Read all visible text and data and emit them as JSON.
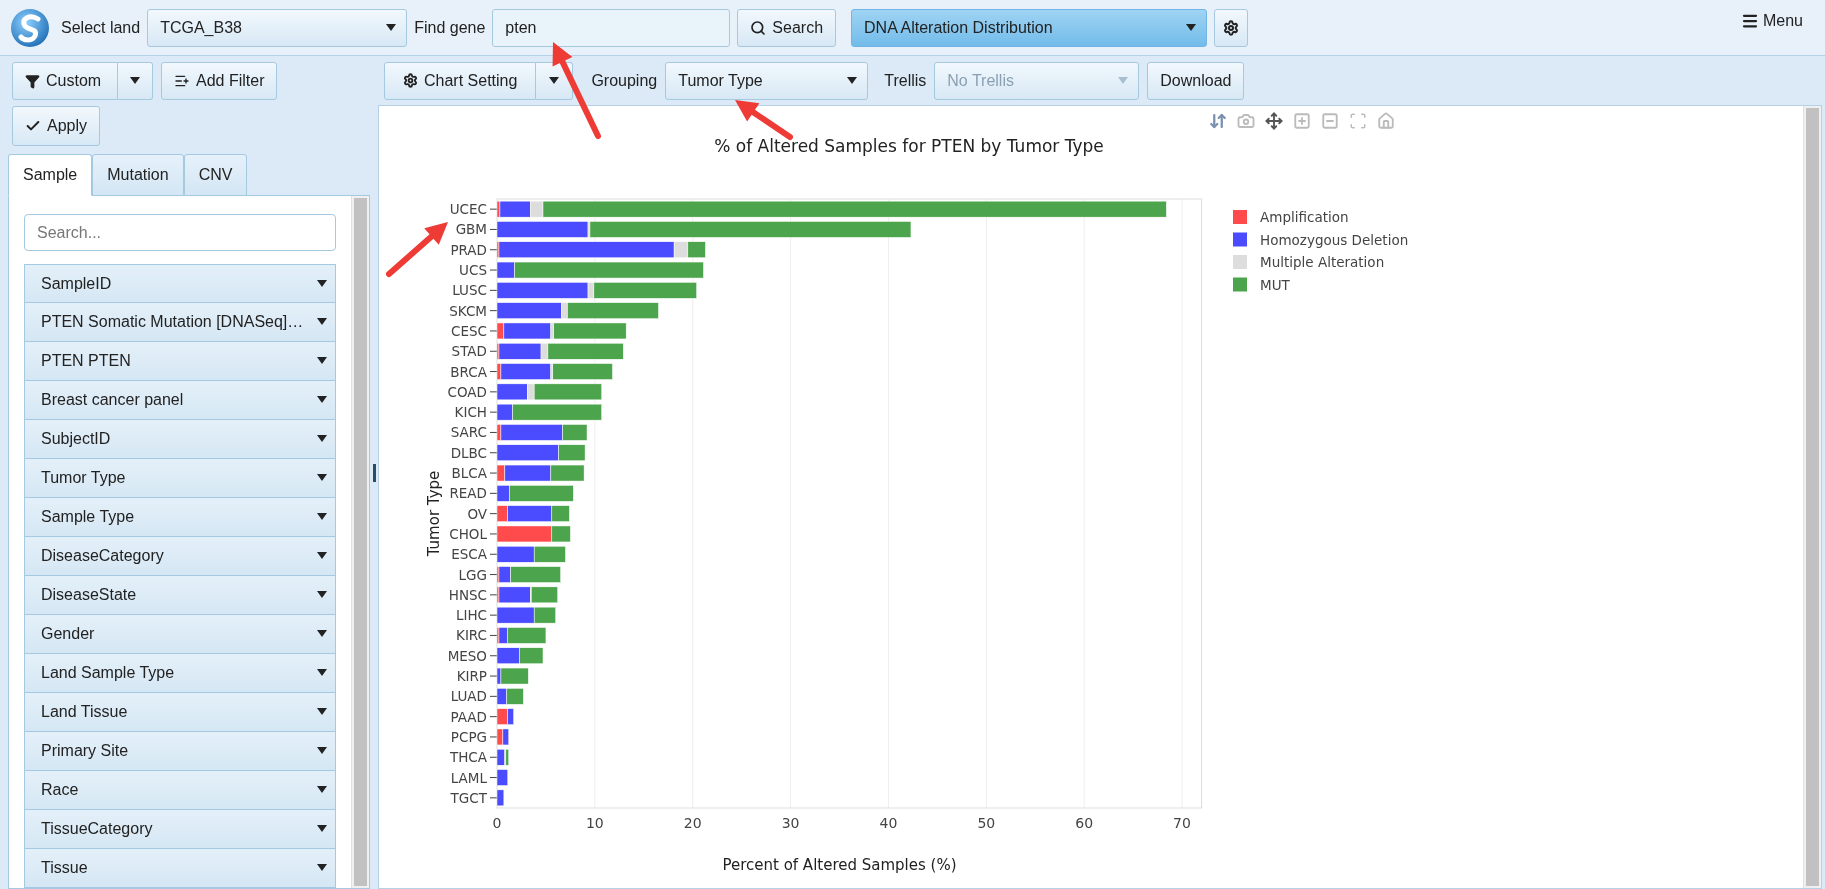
{
  "top_bar": {
    "land_label": "Select land",
    "land_value": "TCGA_B38",
    "gene_label": "Find gene",
    "gene_value": "pten",
    "search_button": "Search",
    "analysis_value": "DNA Alteration Distribution",
    "menu_button": "Menu"
  },
  "filter_bar": {
    "custom_button": "Custom",
    "add_filter_button": "Add Filter",
    "apply_button": "Apply"
  },
  "tabs": [
    {
      "label": "Sample",
      "selected": true
    },
    {
      "label": "Mutation",
      "selected": false
    },
    {
      "label": "CNV",
      "selected": false
    }
  ],
  "sample_search": {
    "placeholder": "Search..."
  },
  "attributes": [
    "SampleID",
    "PTEN Somatic Mutation [DNASeq]…",
    "PTEN PTEN",
    "Breast cancer panel",
    "SubjectID",
    "Tumor Type",
    "Sample Type",
    "DiseaseCategory",
    "DiseaseState",
    "Gender",
    "Land Sample Type",
    "Land Tissue",
    "Primary Site",
    "Race",
    "TissueCategory",
    "Tissue"
  ],
  "chart_toolbar": {
    "chart_setting_button": "Chart Setting",
    "grouping_label": "Grouping",
    "grouping_value": "Tumor Type",
    "trellis_label": "Trellis",
    "trellis_value": "No Trellis",
    "trellis_disabled": true,
    "download_button": "Download"
  },
  "chart": {
    "chart_data": {
      "type": "bar",
      "orientation": "horizontal",
      "stacked": true,
      "title": "% of Altered Samples for PTEN by Tumor Type",
      "xlabel": "Percent of Altered Samples (%)",
      "ylabel": "Tumor Type",
      "xlim": [
        0,
        72
      ],
      "grid": true,
      "legend": true,
      "xticks": [
        0,
        10,
        20,
        30,
        40,
        50,
        60,
        70
      ],
      "categories": [
        "UCEC",
        "GBM",
        "PRAD",
        "UCS",
        "LUSC",
        "SKCM",
        "CESC",
        "STAD",
        "BRCA",
        "COAD",
        "KICH",
        "SARC",
        "DLBC",
        "BLCA",
        "READ",
        "OV",
        "CHOL",
        "ESCA",
        "LGG",
        "HNSC",
        "LIHC",
        "KIRC",
        "MESO",
        "KIRP",
        "LUAD",
        "PAAD",
        "PCPG",
        "THCA",
        "LAML",
        "TGCT"
      ],
      "series": [
        {
          "name": "Amplification",
          "color": "#ff4b4b",
          "values": [
            0.3,
            0,
            0.2,
            0,
            0,
            0,
            0.7,
            0.2,
            0.4,
            0,
            0,
            0.4,
            0,
            0.8,
            0,
            1.1,
            5.6,
            0,
            0.2,
            0.2,
            0,
            0.2,
            0,
            0,
            0,
            1.1,
            0.6,
            0,
            0,
            0
          ]
        },
        {
          "name": "Homozygous Deletion",
          "color": "#4b4bff",
          "values": [
            3.1,
            9.3,
            17.9,
            1.8,
            9.3,
            6.6,
            4.8,
            4.3,
            5.1,
            3.1,
            1.6,
            6.3,
            6.3,
            4.7,
            1.3,
            4.5,
            0,
            3.8,
            1.2,
            3.2,
            3.8,
            0.9,
            2.3,
            0.4,
            1.0,
            0.6,
            0.6,
            0.8,
            1.1,
            0.7
          ]
        },
        {
          "name": "Multiple Alteration",
          "color": "#dddddd",
          "values": [
            1.3,
            0.2,
            1.4,
            0,
            0.6,
            0.6,
            0.3,
            0.7,
            0.2,
            0.7,
            0,
            0,
            0,
            0,
            0,
            0,
            0,
            0,
            0,
            0.1,
            0,
            0,
            0,
            0,
            0,
            0,
            0,
            0.1,
            0,
            0
          ]
        },
        {
          "name": "MUT",
          "color": "#4ca54c",
          "values": [
            63.7,
            32.8,
            1.8,
            19.3,
            10.5,
            9.3,
            7.4,
            7.7,
            6.1,
            6.9,
            9.1,
            2.5,
            2.7,
            3.4,
            6.5,
            1.8,
            1.9,
            3.2,
            5.1,
            2.7,
            2.2,
            3.9,
            2.4,
            2.8,
            1.7,
            0,
            0,
            0.3,
            0,
            0
          ]
        }
      ]
    }
  }
}
